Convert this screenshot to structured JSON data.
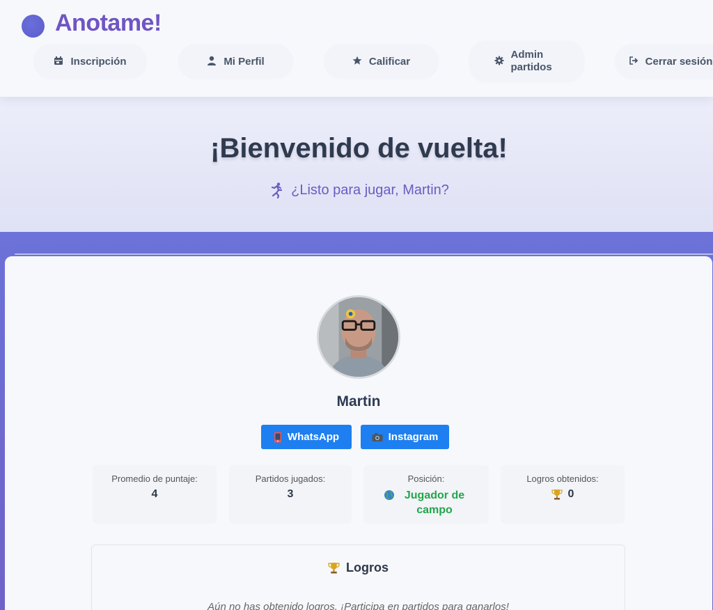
{
  "app": {
    "brand": "Anotame!"
  },
  "nav": {
    "items": [
      {
        "label": "Inscripción",
        "icon": "calendar-icon"
      },
      {
        "label": "Mi Perfil",
        "icon": "user-icon"
      },
      {
        "label": "Calificar",
        "icon": "star-icon"
      },
      {
        "label": "Admin partidos",
        "icon": "gear-icon"
      },
      {
        "label": "Cerrar sesión",
        "icon": "logout-icon"
      }
    ]
  },
  "hero": {
    "title": "¡Bienvenido de vuelta!",
    "subtitle": "¿Listo para jugar, Martin?",
    "subtitle_icon": "runner-icon"
  },
  "profile": {
    "name": "Martin",
    "social": {
      "whatsapp": "WhatsApp",
      "instagram": "Instagram"
    },
    "stats": {
      "avg_label": "Promedio de puntaje:",
      "avg_value": "4",
      "played_label": "Partidos jugados:",
      "played_value": "3",
      "position_label": "Posición:",
      "position_value": "Jugador de campo",
      "achievements_label": "Logros obtenidos:",
      "achievements_value": "0"
    }
  },
  "logros": {
    "title": "Logros",
    "empty": "Aún no has obtenido logros. ¡Participa en partidos para ganarlos!"
  },
  "colors": {
    "brand": "#6f55c4",
    "primary_button": "#1e7ff0",
    "position_green": "#22a64a",
    "purple_bg": "#6c72d8"
  }
}
